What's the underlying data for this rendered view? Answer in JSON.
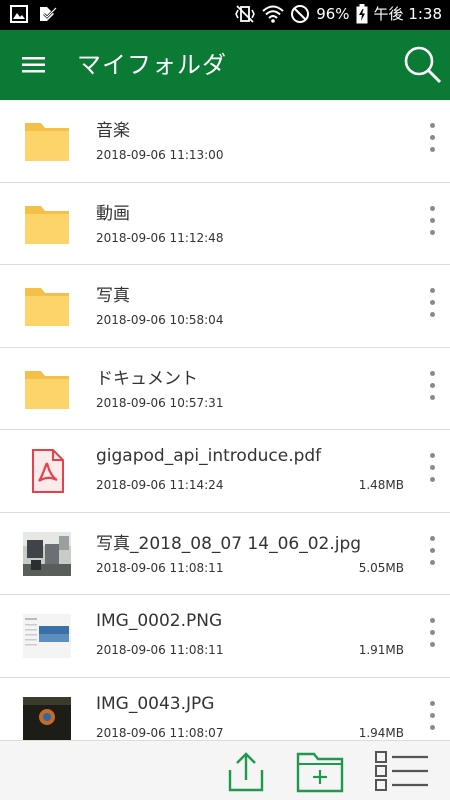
{
  "status_bar": {
    "battery": "96%",
    "time": "午後 1:38",
    "icons": [
      "gallery-icon",
      "check-icon",
      "vibrate-icon",
      "wifi-icon",
      "dnd-icon",
      "battery-icon"
    ]
  },
  "app_bar": {
    "title": "マイフォルダ",
    "color": "#0a7a35",
    "menu_icon": "hamburger-menu-icon",
    "search_icon": "search-icon"
  },
  "files": [
    {
      "name": "音楽",
      "date": "2018-09-06 11:13:00",
      "size": "",
      "type": "folder"
    },
    {
      "name": "動画",
      "date": "2018-09-06 11:12:48",
      "size": "",
      "type": "folder"
    },
    {
      "name": "写真",
      "date": "2018-09-06 10:58:04",
      "size": "",
      "type": "folder"
    },
    {
      "name": "ドキュメント",
      "date": "2018-09-06 10:57:31",
      "size": "",
      "type": "folder"
    },
    {
      "name": "gigapod_api_introduce.pdf",
      "date": "2018-09-06 11:14:24",
      "size": "1.48MB",
      "type": "pdf"
    },
    {
      "name": "写真_2018_08_07 14_06_02.jpg",
      "date": "2018-09-06 11:08:11",
      "size": "5.05MB",
      "type": "image-photo"
    },
    {
      "name": "IMG_0002.PNG",
      "date": "2018-09-06 11:08:11",
      "size": "1.91MB",
      "type": "image-screenshot"
    },
    {
      "name": "IMG_0043.JPG",
      "date": "2018-09-06 11:08:07",
      "size": "1.94MB",
      "type": "image-dark"
    }
  ],
  "bottom_bar": {
    "upload_icon": "upload-icon",
    "new_folder_icon": "new-folder-icon",
    "list_view_icon": "list-view-icon",
    "accent": "#1f9a4c"
  }
}
